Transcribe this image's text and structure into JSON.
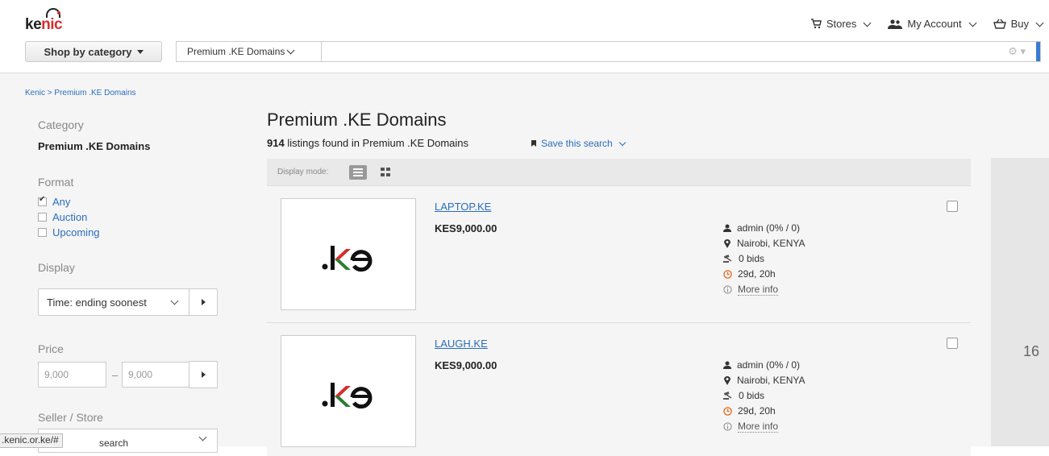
{
  "brand": {
    "name_part1": "ke",
    "name_part2": "nic"
  },
  "top_nav": {
    "stores": "Stores",
    "my_account": "My Account",
    "buy": "Buy"
  },
  "search": {
    "shop_by_category": "Shop by category",
    "category_value": "Premium .KE Domains",
    "placeholder": ""
  },
  "breadcrumb": {
    "root": "Kenic",
    "sep": ">",
    "current": "Premium .KE Domains"
  },
  "sidebar": {
    "category_heading": "Category",
    "category_value": "Premium .KE Domains",
    "format_heading": "Format",
    "format_options": [
      {
        "label": "Any",
        "checked": true
      },
      {
        "label": "Auction",
        "checked": false
      },
      {
        "label": "Upcoming",
        "checked": false
      }
    ],
    "display_heading": "Display",
    "display_sort": "Time: ending soonest",
    "price_heading": "Price",
    "price_min": "9,000",
    "price_max": "9,000",
    "price_dash": "–",
    "seller_heading": "Seller / Store",
    "seller_value": "search"
  },
  "main": {
    "title": "Premium .KE Domains",
    "count": "914",
    "count_suffix": "listings found in Premium .KE Domains",
    "save_search": "Save this search",
    "display_mode_label": "Display mode:"
  },
  "listings": [
    {
      "title": "LAPTOP.KE",
      "price": "KES9,000.00",
      "seller": "admin (0% / 0)",
      "location": "Nairobi, KENYA",
      "bids": "0 bids",
      "time_left": "29d, 20h",
      "more_info": "More info"
    },
    {
      "title": "LAUGH.KE",
      "price": "KES9,000.00",
      "seller": "admin (0% / 0)",
      "location": "Nairobi, KENYA",
      "bids": "0 bids",
      "time_left": "29d, 20h",
      "more_info": "More info"
    }
  ],
  "right_panel": {
    "number": "16"
  },
  "status_bar": {
    "url": ".kenic.or.ke/#"
  },
  "colors": {
    "link": "#2a6ebb",
    "brand_red": "#d32f2f",
    "clock_orange": "#e8661c",
    "logo_green": "#2e7d32"
  }
}
